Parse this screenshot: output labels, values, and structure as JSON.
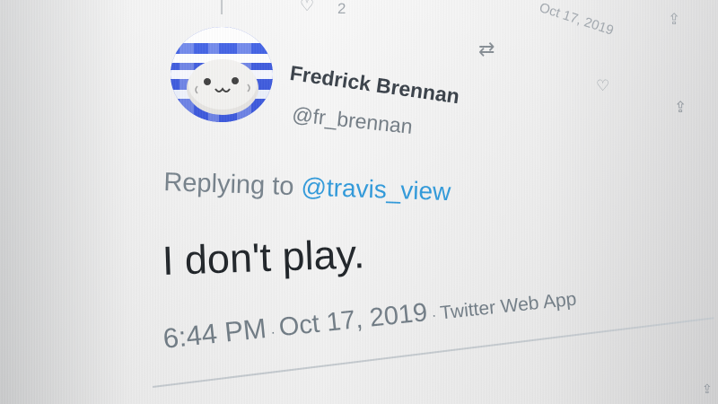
{
  "previous_tweet": {
    "heart_icon": "heart-icon",
    "reply_count": "2",
    "date": "Oct 17, 2019",
    "share_icon": "share-icon"
  },
  "tweet": {
    "display_name": "Fredrick Brennan",
    "username": "@fr_brennan",
    "reply_prefix": "Replying to ",
    "reply_handle": "@travis_view",
    "text": "I don't play.",
    "time": "6:44 PM",
    "separator": " · ",
    "date": "Oct 17, 2019",
    "app": "Twitter Web App"
  },
  "actions": {
    "retweet_icon": "retweet-icon",
    "like_icon": "heart-icon",
    "share_icon": "share-icon"
  },
  "colors": {
    "link_blue": "#1a91da",
    "avatar_blue": "#1e3fd8"
  }
}
